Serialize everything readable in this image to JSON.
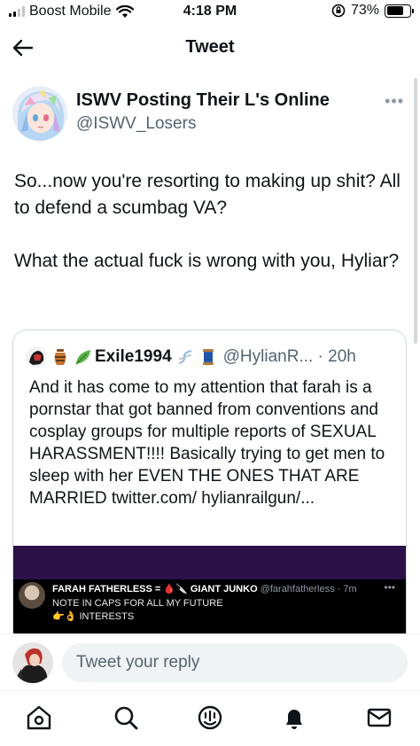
{
  "status_bar": {
    "carrier": "Boost Mobile",
    "time": "4:18 PM",
    "battery": "73%",
    "battery_level": 0.73
  },
  "header": {
    "title": "Tweet"
  },
  "tweet": {
    "author_name": "ISWV Posting Their L's Online",
    "author_handle": "@ISWV_Losers",
    "text_p1": "So...now you're resorting to making up shit? All to defend a scumbag VA?",
    "text_p2": "What the actual fuck is wrong with you, Hyliar?"
  },
  "quoted_tweet": {
    "name": "Exile1994",
    "handle_time": "@HylianR... · 20h",
    "text": "And it has come to my attention that farah is a pornstar that got banned from conventions and cosplay groups for multiple reports of SEXUAL HARASSMENT!!!! Basically trying to get men to sleep with her EVEN THE ONES THAT ARE MARRIED twitter.com/ hylianrailgun/...",
    "media": {
      "name": "FARAH FATHERLESS = 🩸🔪 GIANT JUNKO",
      "handle_time": "@farahfatherless · 7m",
      "line1": "NOTE IN CAPS FOR ALL MY FUTURE",
      "line2": "👉👌 INTERESTS"
    }
  },
  "reply": {
    "placeholder": "Tweet your reply"
  },
  "icons": {
    "back": "arrow-left-icon",
    "home": "home-icon",
    "search": "search-icon",
    "spaces": "spaces-icon",
    "notifications": "bell-icon",
    "messages": "mail-icon"
  }
}
